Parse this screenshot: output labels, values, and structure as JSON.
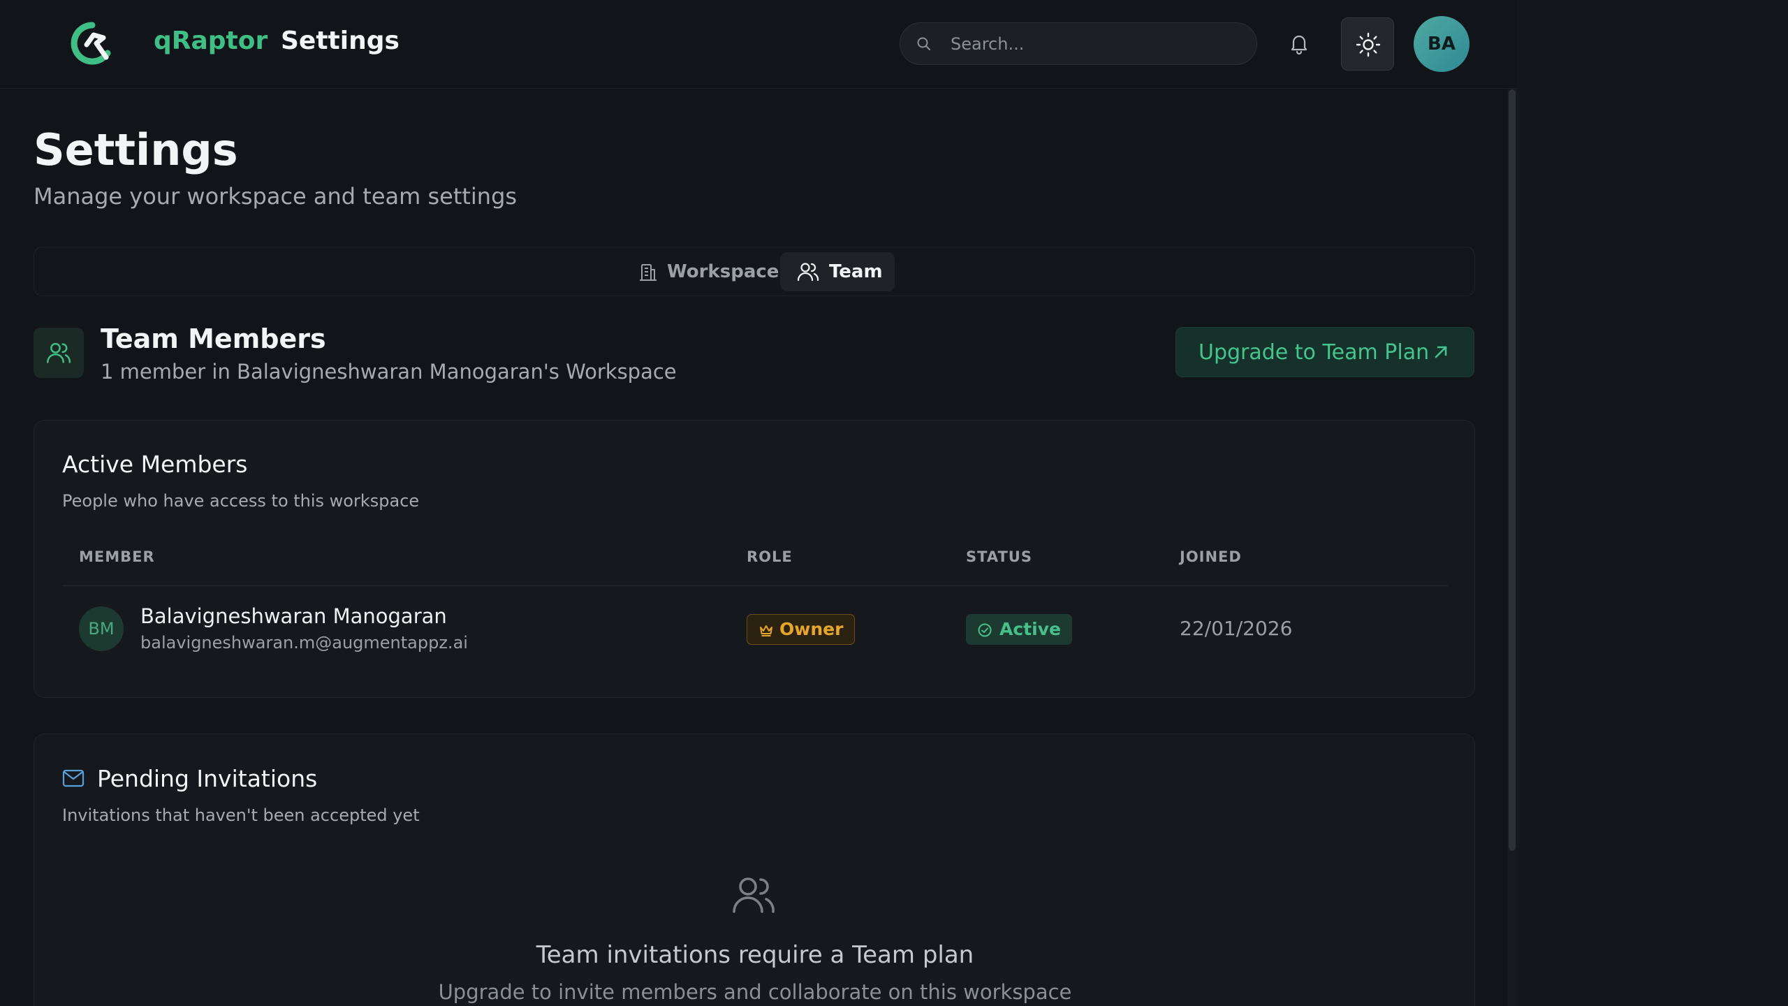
{
  "header": {
    "brand": "qRaptor",
    "title": "Settings",
    "search_placeholder": "Search...",
    "avatar_initials": "BA"
  },
  "page": {
    "title": "Settings",
    "subtitle": "Manage your workspace and team settings"
  },
  "tabs": [
    {
      "label": "Workspace",
      "icon": "building-icon",
      "active": false
    },
    {
      "label": "Team",
      "icon": "users-icon",
      "active": true
    }
  ],
  "team_section": {
    "title": "Team Members",
    "subtitle": "1 member in Balavigneshwaran Manogaran's Workspace",
    "upgrade_label": "Upgrade to Team Plan"
  },
  "active_members": {
    "title": "Active Members",
    "subtitle": "People who have access to this workspace",
    "columns": [
      "MEMBER",
      "ROLE",
      "STATUS",
      "JOINED"
    ],
    "rows": [
      {
        "initials": "BM",
        "name": "Balavigneshwaran Manogaran",
        "email": "balavigneshwaran.m@augmentappz.ai",
        "role": "Owner",
        "status": "Active",
        "joined": "22/01/2026"
      }
    ]
  },
  "pending": {
    "title": "Pending Invitations",
    "subtitle": "Invitations that haven't been accepted yet",
    "empty_title": "Team invitations require a Team plan",
    "empty_sub": "Upgrade to invite members and collaborate on this workspace"
  },
  "colors": {
    "accent": "#3fbf86",
    "background": "#111418",
    "owner_badge": "#e6a52b",
    "active_badge": "#47c08c"
  }
}
